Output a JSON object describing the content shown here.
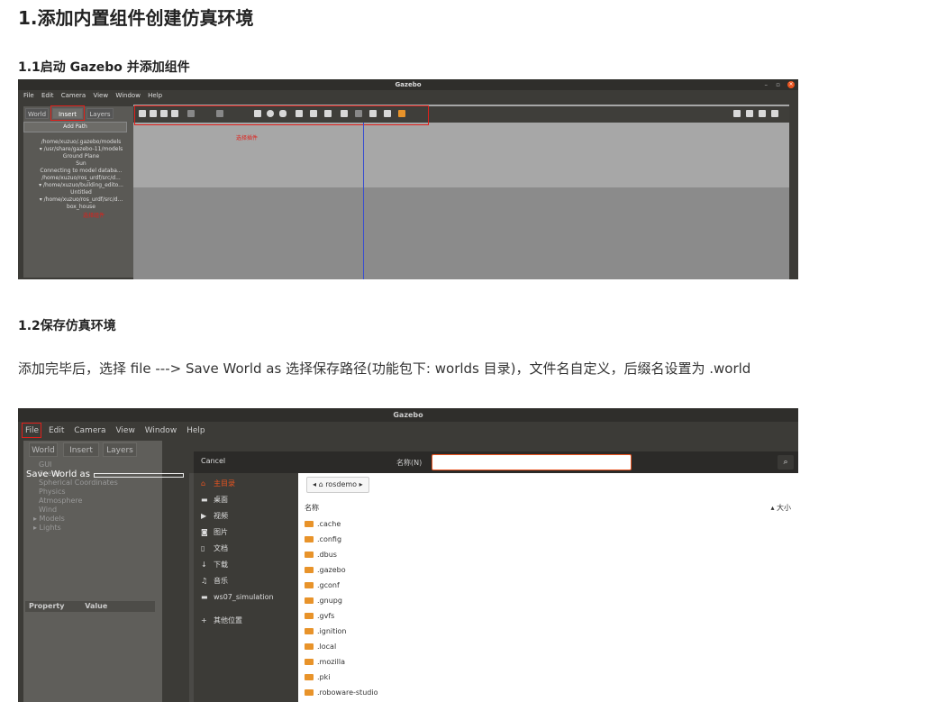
{
  "doc": {
    "title": "1.添加内置组件创建仿真环境",
    "section1": "1.1启动 Gazebo 并添加组件",
    "section2": "1.2保存仿真环境",
    "paragraph": "添加完毕后，选择 file ---> Save World as 选择保存路径(功能包下: worlds 目录)，文件名自定义，后缀名设置为 .world"
  },
  "shot1": {
    "window_title": "Gazebo",
    "menu": [
      "File",
      "Edit",
      "Camera",
      "View",
      "Window",
      "Help"
    ],
    "tabs": [
      "World",
      "Insert",
      "Layers"
    ],
    "add_path": "Add Path",
    "paths": [
      "/home/xuzuo/.gazebo/models",
      "▾ /usr/share/gazebo-11/models",
      "Ground Plane",
      "Sun",
      "Connecting to model databa...",
      "/home/xuzuo/ros_urdf/src/d...",
      "▾ /home/xuzuo/building_edito...",
      "Untitled",
      "▾ /home/xuzuo/ros_urdf/src/d...",
      "box_house"
    ],
    "annotation_toolbar": "选择插件",
    "annotation_left": "选择组件"
  },
  "shot2": {
    "window_title": "Gazebo",
    "menu": [
      "File",
      "Edit",
      "Camera",
      "View",
      "Window",
      "Help"
    ],
    "tabs": [
      "World",
      "Insert",
      "Layers"
    ],
    "tree": [
      "GUI",
      "Scene",
      "Spherical Coordinates",
      "Physics",
      "Atmosphere",
      "Wind",
      "▸ Models",
      "▸ Lights"
    ],
    "save_world_as": "Save World as",
    "property_header": "Property",
    "value_header": "Value",
    "dialog": {
      "cancel": "Cancel",
      "name_label": "名称(N)",
      "name_value": "",
      "crumb": "rosdemo",
      "col_name": "名称",
      "col_size": "大小",
      "places": [
        {
          "icon": "⌂",
          "label": "主目录",
          "active": true
        },
        {
          "icon": "▬",
          "label": "桌面"
        },
        {
          "icon": "▶",
          "label": "视频"
        },
        {
          "icon": "◙",
          "label": "图片"
        },
        {
          "icon": "▯",
          "label": "文档"
        },
        {
          "icon": "↓",
          "label": "下载"
        },
        {
          "icon": "♫",
          "label": "音乐"
        },
        {
          "icon": "▬",
          "label": "ws07_simulation"
        },
        {
          "icon": "+",
          "label": "其他位置"
        }
      ],
      "files": [
        ".cache",
        ".config",
        ".dbus",
        ".gazebo",
        ".gconf",
        ".gnupg",
        ".gvfs",
        ".ignition",
        ".local",
        ".mozilla",
        ".pki",
        ".roboware-studio"
      ]
    }
  }
}
